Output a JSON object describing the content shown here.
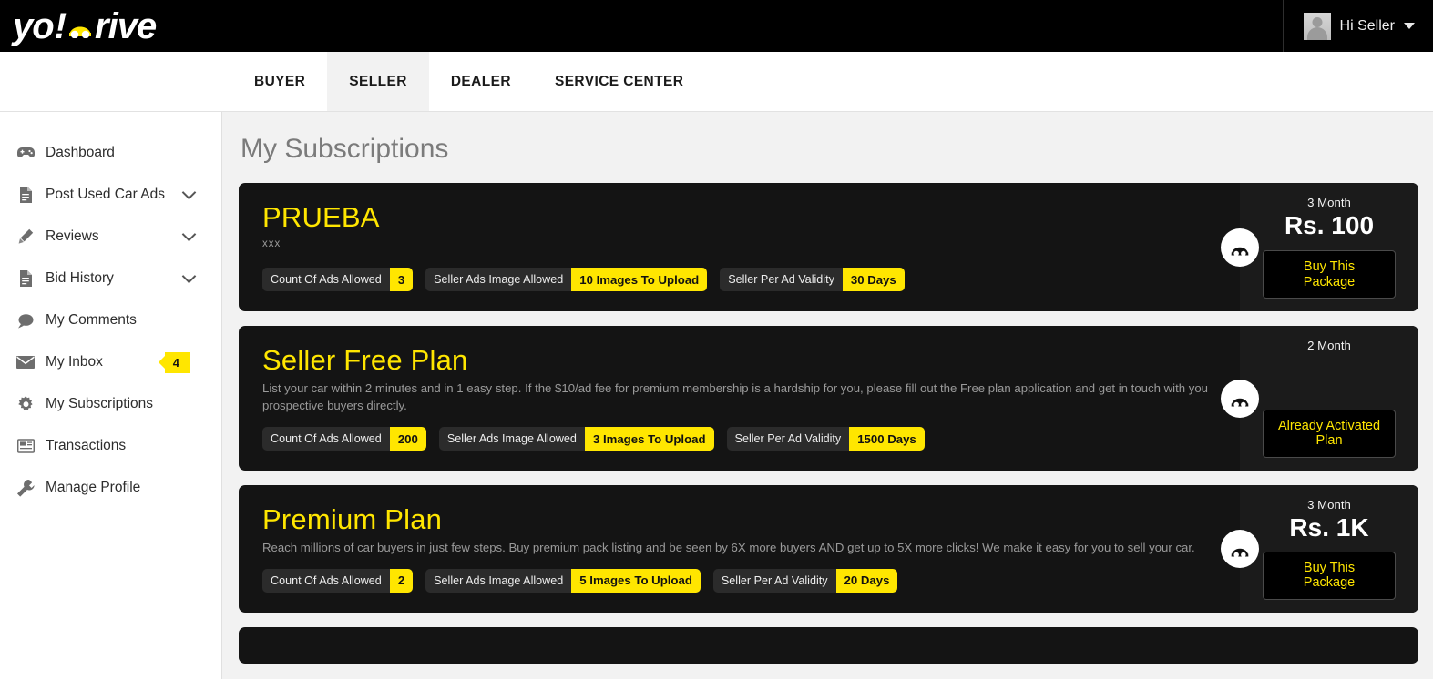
{
  "brand": {
    "logo_text_start": "yo",
    "logo_excl": "!",
    "logo_icon": "car-icon",
    "logo_text_end": "rive"
  },
  "header": {
    "user_greeting": "Hi Seller",
    "avatar_icon": "user-avatar-placeholder",
    "caret_icon": "chevron-down-icon"
  },
  "tabs": [
    {
      "label": "BUYER",
      "active": false
    },
    {
      "label": "SELLER",
      "active": true
    },
    {
      "label": "DEALER",
      "active": false
    },
    {
      "label": "SERVICE CENTER",
      "active": false
    }
  ],
  "sidebar": {
    "items": [
      {
        "label": "Dashboard",
        "icon": "dashboard-icon",
        "chevron": false,
        "badge": null
      },
      {
        "label": "Post Used Car Ads",
        "icon": "document-icon",
        "chevron": true,
        "badge": null
      },
      {
        "label": "Reviews",
        "icon": "pencil-icon",
        "chevron": true,
        "badge": null
      },
      {
        "label": "Bid History",
        "icon": "document-icon",
        "chevron": true,
        "badge": null
      },
      {
        "label": "My Comments",
        "icon": "comment-icon",
        "chevron": false,
        "badge": null
      },
      {
        "label": "My Inbox",
        "icon": "envelope-icon",
        "chevron": false,
        "badge": "4"
      },
      {
        "label": "My Subscriptions",
        "icon": "gear-icon",
        "chevron": false,
        "badge": null
      },
      {
        "label": "Transactions",
        "icon": "transactions-icon",
        "chevron": false,
        "badge": null
      },
      {
        "label": "Manage Profile",
        "icon": "wrench-icon",
        "chevron": false,
        "badge": null
      }
    ]
  },
  "main": {
    "page_title": "My Subscriptions",
    "plans": [
      {
        "name": "PRUEBA",
        "description": "xxx",
        "description_is_tiny": true,
        "features": [
          {
            "label": "Count Of Ads Allowed",
            "value": "3"
          },
          {
            "label": "Seller Ads Image Allowed",
            "value": "10 Images To Upload"
          },
          {
            "label": "Seller Per Ad Validity",
            "value": "30 Days"
          }
        ],
        "period": "3 Month",
        "price": "Rs. 100",
        "action_label": "Buy This Package",
        "badge_icon": "car-icon"
      },
      {
        "name": "Seller Free Plan",
        "description": "List your car within 2 minutes and in 1 easy step. If the $10/ad fee for premium membership is a hardship for you, please fill out the Free plan application and get in touch with you prospective buyers directly.",
        "description_is_tiny": false,
        "features": [
          {
            "label": "Count Of Ads Allowed",
            "value": "200"
          },
          {
            "label": "Seller Ads Image Allowed",
            "value": "3 Images To Upload"
          },
          {
            "label": "Seller Per Ad Validity",
            "value": "1500 Days"
          }
        ],
        "period": "2 Month",
        "price": "",
        "action_label": "Already Activated Plan",
        "badge_icon": "car-icon"
      },
      {
        "name": "Premium Plan",
        "description": "Reach millions of car buyers in just few steps. Buy premium pack listing and be seen by 6X more buyers AND get up to 5X more clicks! We make it easy for you to sell your car.",
        "description_is_tiny": false,
        "features": [
          {
            "label": "Count Of Ads Allowed",
            "value": "2"
          },
          {
            "label": "Seller Ads Image Allowed",
            "value": "5 Images To Upload"
          },
          {
            "label": "Seller Per Ad Validity",
            "value": "20 Days"
          }
        ],
        "period": "3 Month",
        "price": "Rs. 1K",
        "action_label": "Buy This Package",
        "badge_icon": "car-icon"
      }
    ]
  },
  "colors": {
    "accent_yellow": "#ffe600",
    "card_bg": "#141414",
    "panel_bg": "#1b1b1b",
    "page_bg": "#f2f2f2",
    "topbar_bg": "#000000"
  }
}
